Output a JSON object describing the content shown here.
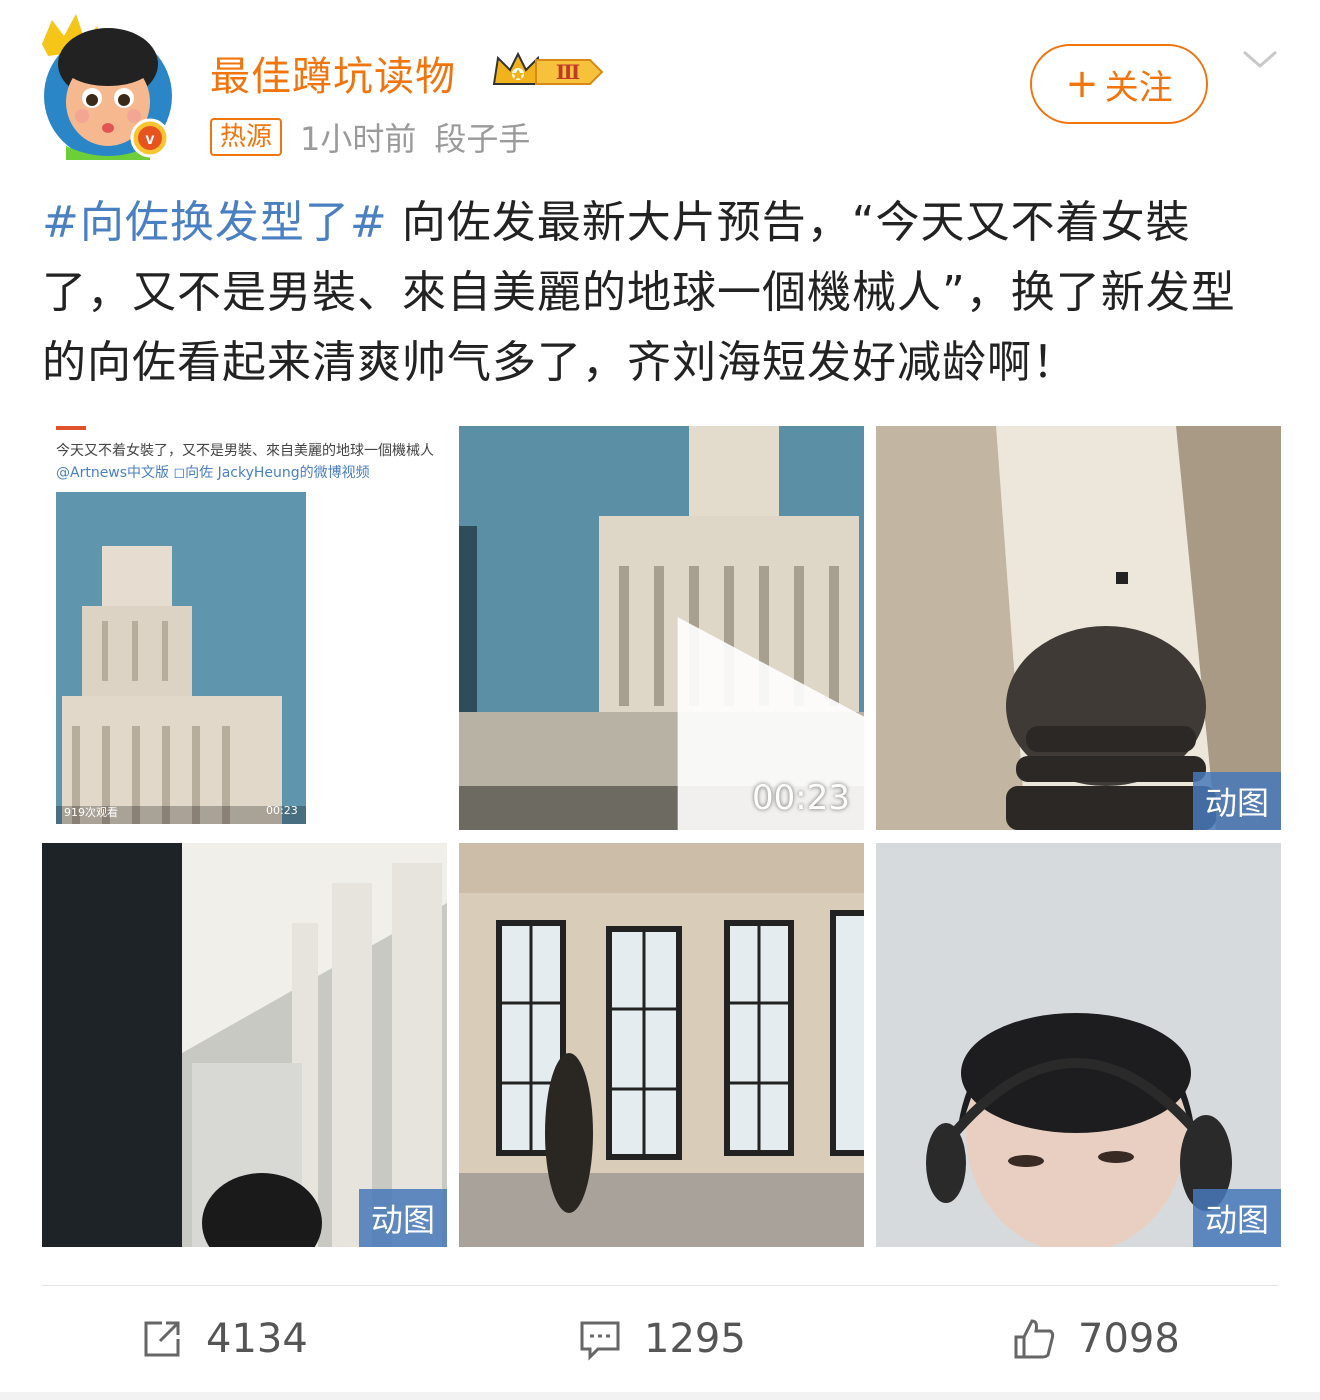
{
  "header": {
    "username": "最佳蹲坑读物",
    "level_badge": "Ⅲ",
    "hot_tag": "热源",
    "time_ago": "1小时前",
    "source": "段子手",
    "follow_label": "关注",
    "follow_plus": "+"
  },
  "post": {
    "hashtag": "#向佐换发型了#",
    "text": "向佐发最新大片预告，“今天又不着女裝了，又不是男裝、來自美麗的地球一個機械人”，换了新发型的向佐看起来清爽帅气多了，齐刘海短发好减龄啊！"
  },
  "media": {
    "screenshot": {
      "caption_text": "今天又不着女裝了，又不是男裝、來自美麗的地球一個機械人",
      "caption_mention": "@Artnews中文版 ◻向佐 JackyHeung的微博视频",
      "views": "919次观看",
      "time": "00:23"
    },
    "video_duration": "00:23",
    "gif_label": "动图"
  },
  "actions": {
    "reposts": "4134",
    "comments": "1295",
    "likes": "7098"
  },
  "colors": {
    "accent_orange": "#f0750f",
    "link_blue": "#4a7fc1"
  },
  "icons": [
    "crown-icon",
    "verified-icon",
    "chevron-down-icon",
    "play-icon",
    "repost-icon",
    "comment-icon",
    "like-icon"
  ]
}
